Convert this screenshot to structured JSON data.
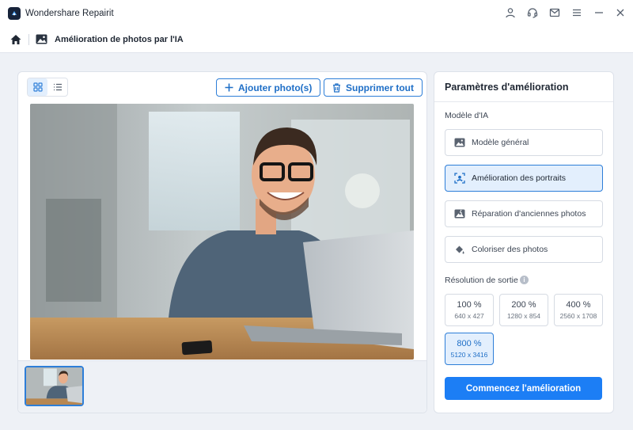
{
  "app": {
    "title": "Wondershare Repairit"
  },
  "titlebar_icons": [
    "user-icon",
    "headset-icon",
    "mail-icon",
    "menu-icon",
    "minimize-icon",
    "close-icon"
  ],
  "breadcrumb": {
    "title": "Amélioration de photos par l'IA"
  },
  "toolbar": {
    "add_label": "Ajouter photo(s)",
    "delete_label": "Supprimer tout"
  },
  "settings": {
    "title": "Paramètres d'amélioration",
    "model_label": "Modèle d'IA",
    "models": [
      {
        "label": "Modèle général",
        "icon": "image-icon",
        "selected": false
      },
      {
        "label": "Amélioration des portraits",
        "icon": "portrait-scan-icon",
        "selected": true
      },
      {
        "label": "Réparation d'anciennes photos",
        "icon": "old-photo-icon",
        "selected": false
      },
      {
        "label": "Coloriser des photos",
        "icon": "paint-bucket-icon",
        "selected": false
      }
    ],
    "resolution_label": "Résolution de sortie",
    "info_glyph": "i",
    "resolutions": [
      {
        "pct": "100 %",
        "dim": "640 x 427",
        "selected": false
      },
      {
        "pct": "200 %",
        "dim": "1280 x 854",
        "selected": false
      },
      {
        "pct": "400 %",
        "dim": "2560 x 1708",
        "selected": false
      },
      {
        "pct": "800 %",
        "dim": "5120 x 3416",
        "selected": true
      }
    ],
    "start_label": "Commencez l'amélioration"
  },
  "colors": {
    "accent": "#1c7ef5",
    "selected_bg": "#e3effd",
    "border": "#d6dbe3"
  }
}
